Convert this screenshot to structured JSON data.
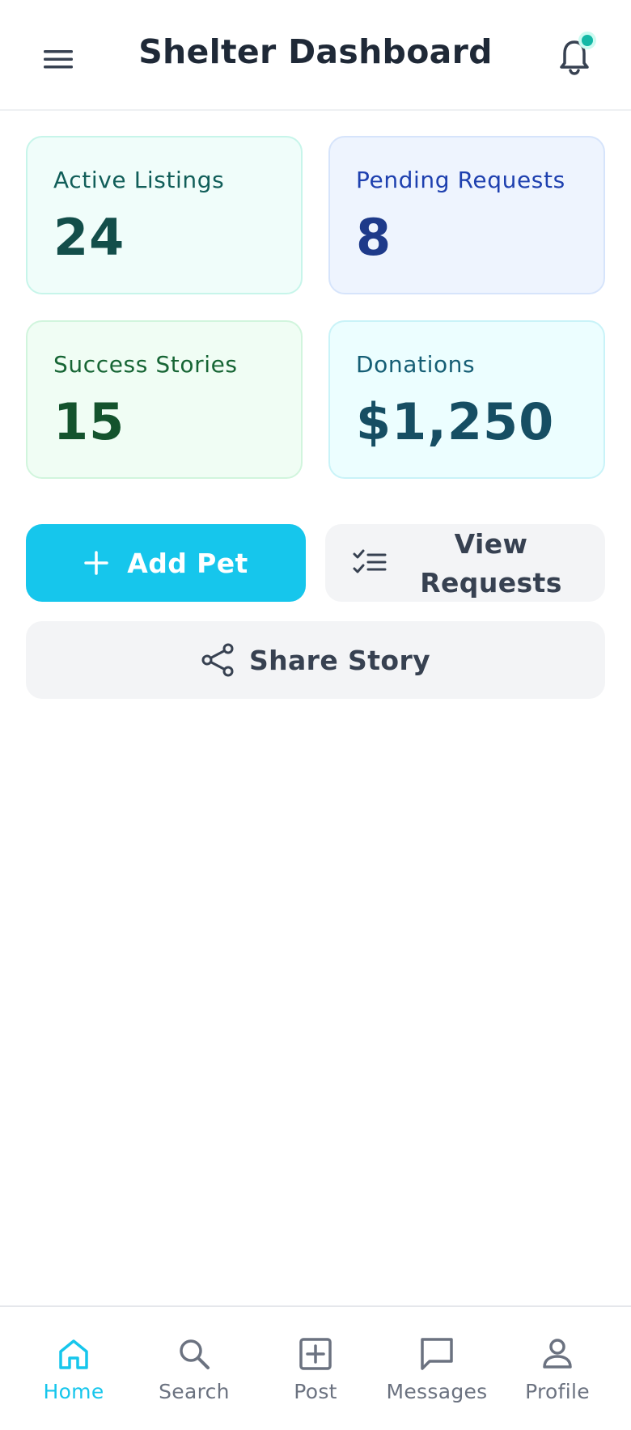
{
  "header": {
    "title": "Shelter Dashboard",
    "menu_icon": "hamburger-menu-icon",
    "notification_icon": "bell-icon",
    "notification_dot_color": "#14b8a6"
  },
  "stats": [
    {
      "label": "Active Listings",
      "value": "24",
      "color": "#f0fdfa"
    },
    {
      "label": "Pending Requests",
      "value": "8",
      "color": "#eef4fe"
    },
    {
      "label": "Success Stories",
      "value": "15",
      "color": "#f0fdf4"
    },
    {
      "label": "Donations",
      "value": "$1,250",
      "color": "#ecfeff"
    }
  ],
  "actions": {
    "add_pet": {
      "label": "Add Pet",
      "icon": "plus-icon",
      "color": "#16c6ec"
    },
    "view_requests": {
      "label": "View Requests",
      "icon": "checklist-icon"
    },
    "share_story": {
      "label": "Share Story",
      "icon": "share-icon"
    }
  },
  "nav": {
    "active": "Home",
    "accent": "#16c6ec",
    "items": [
      {
        "label": "Home",
        "icon": "home-icon"
      },
      {
        "label": "Search",
        "icon": "search-icon"
      },
      {
        "label": "Post",
        "icon": "plus-square-icon"
      },
      {
        "label": "Messages",
        "icon": "message-icon"
      },
      {
        "label": "Profile",
        "icon": "user-icon"
      }
    ]
  }
}
